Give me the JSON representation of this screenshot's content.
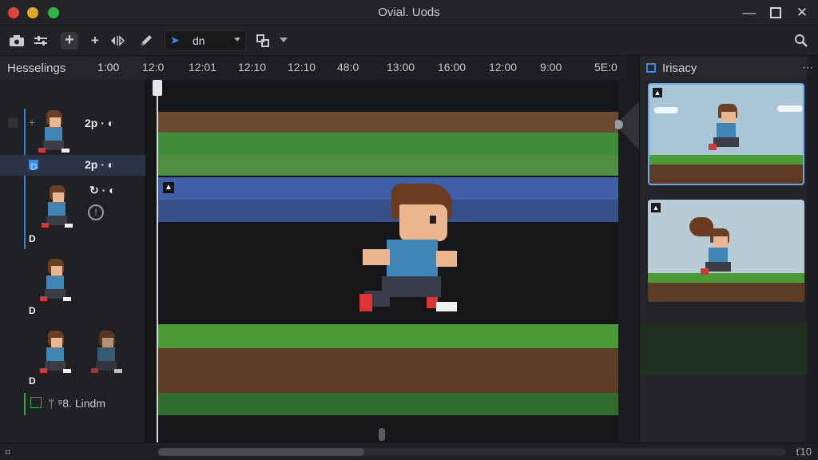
{
  "window": {
    "title": "Ovial. Uods"
  },
  "toolbar": {
    "mode_label": "dn"
  },
  "left_panel": {
    "header": "Hesselings",
    "layers": [
      {
        "value": "2p · ◐"
      },
      {
        "value": "2p · ◐"
      },
      {
        "value": "↻ · ◐"
      }
    ],
    "d_marks": [
      "D",
      "D",
      "D",
      "D"
    ],
    "footer_label": "ᛘ ⁹8. Lindm"
  },
  "ruler": {
    "ticks": [
      "1:00",
      "12:0",
      "12:01",
      "12:10",
      "12:10",
      "48:0",
      "13:00",
      "16:00",
      "12:00",
      "9:00",
      "5E:0"
    ]
  },
  "right_panel": {
    "header": "Irisacy"
  },
  "status": {
    "left": "⌗",
    "right": "ť10"
  },
  "colors": {
    "accent": "#3d8ae6",
    "grass": "#4a9a35",
    "dirt": "#5d3b24",
    "band_blue": "#3f5fa8",
    "band_green": "#3f8c3a"
  }
}
